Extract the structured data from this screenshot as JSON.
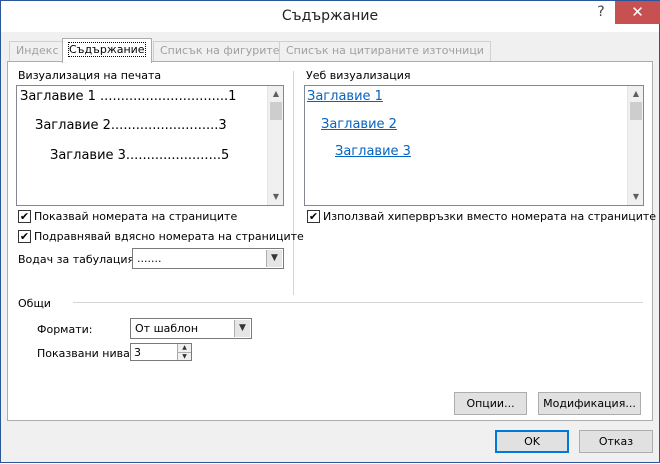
{
  "window": {
    "title": "Съдържание",
    "help": "?",
    "close": "✕"
  },
  "tabs": [
    {
      "label": "Индекс",
      "active": false
    },
    {
      "label": "Съдържание",
      "active": true
    },
    {
      "label": "Списък на фигурите",
      "active": false
    },
    {
      "label": "Списък на цитираните източници",
      "active": false
    }
  ],
  "print_preview": {
    "label": "Визуализация на печата",
    "lines": [
      "Заглавие 1 ...............................1",
      "Заглавие 2..........................3",
      "Заглавие 3.......................5"
    ]
  },
  "web_preview": {
    "label": "Уеб визуализация",
    "links": [
      "Заглавие 1",
      "Заглавие 2",
      "Заглавие 3"
    ]
  },
  "options": {
    "show_page_numbers": {
      "label": "Показвай номерата на страниците",
      "checked": true,
      "mark": "✔"
    },
    "right_align": {
      "label": "Подравнявай вдясно номерата на страниците",
      "checked": true,
      "mark": "✔"
    },
    "use_hyperlinks": {
      "label": "Използвай хипервръзки вместо номерата на страниците",
      "checked": true,
      "mark": "✔"
    },
    "tab_leader": {
      "label": "Водач за табулация:",
      "value": "......."
    }
  },
  "general": {
    "label": "Общи",
    "formats": {
      "label": "Формати:",
      "value": "От шаблон"
    },
    "levels": {
      "label": "Показвани нива:",
      "value": "3"
    }
  },
  "buttons": {
    "options": "Опции...",
    "modify": "Модификация...",
    "ok": "OK",
    "cancel": "Отказ"
  }
}
